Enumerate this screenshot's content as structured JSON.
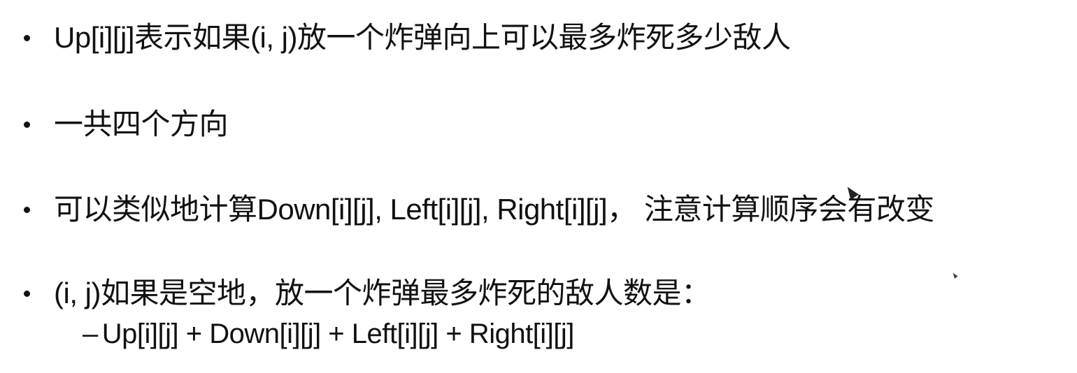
{
  "bullets": [
    {
      "text": "Up[i][j]表示如果(i, j)放一个炸弹向上可以最多炸死多少敌人"
    },
    {
      "text": "一共四个方向"
    },
    {
      "text": "可以类似地计算Down[i][j], Left[i][j], Right[i][j]， 注意计算顺序会有改变"
    },
    {
      "text": "(i, j)如果是空地，放一个炸弹最多炸死的敌人数是："
    }
  ],
  "sub_bullet": {
    "dash": "–",
    "text": "Up[i][j] + Down[i][j] + Left[i][j] + Right[i][j]"
  },
  "icons": {
    "bullet": "bullet-dot-icon",
    "cursor": "mouse-pointer-icon"
  },
  "colors": {
    "background": "#ffffff",
    "text": "#111111"
  }
}
